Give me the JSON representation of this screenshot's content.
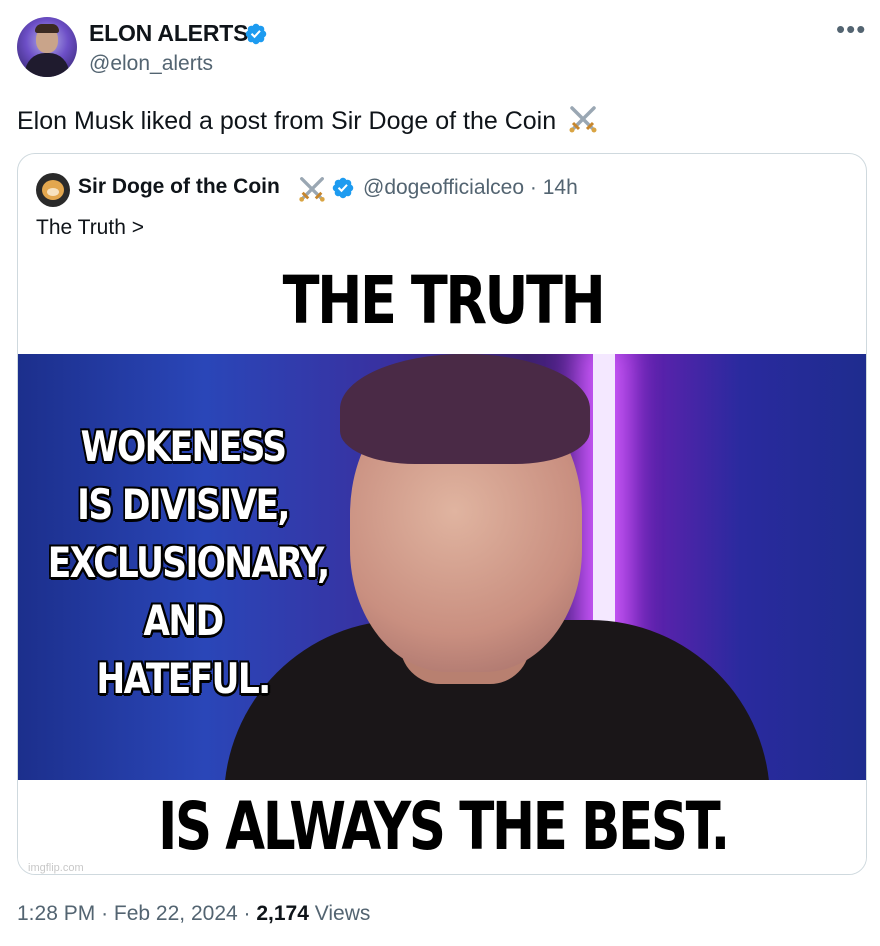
{
  "author": {
    "name": "ELON ALERTS",
    "handle": "@elon_alerts",
    "verified": true
  },
  "more_icon": "more-horizontal-icon",
  "tweet": {
    "text": "Elon Musk liked a post from Sir Doge of the Coin"
  },
  "quote": {
    "name": "Sir Doge of the Coin",
    "handle": "@dogeofficialceo",
    "separator": "·",
    "time": "14h",
    "text": "The Truth >",
    "verified": true
  },
  "meme": {
    "top": "THE TRUTH",
    "left_lines": [
      "WOKENESS",
      "IS DIVISIVE,",
      "EXCLUSIONARY,",
      "AND",
      "HATEFUL."
    ],
    "bottom": "IS ALWAYS THE BEST.",
    "watermark": "imgflip.com"
  },
  "footer": {
    "time": "1:28 PM",
    "sep1": "·",
    "date": "Feb 22, 2024",
    "sep2": "·",
    "views": "2,174",
    "views_label": "Views"
  },
  "colors": {
    "text": "#0f1419",
    "secondary": "#536471",
    "verified": "#1d9bf0",
    "border": "#cfd9de"
  }
}
